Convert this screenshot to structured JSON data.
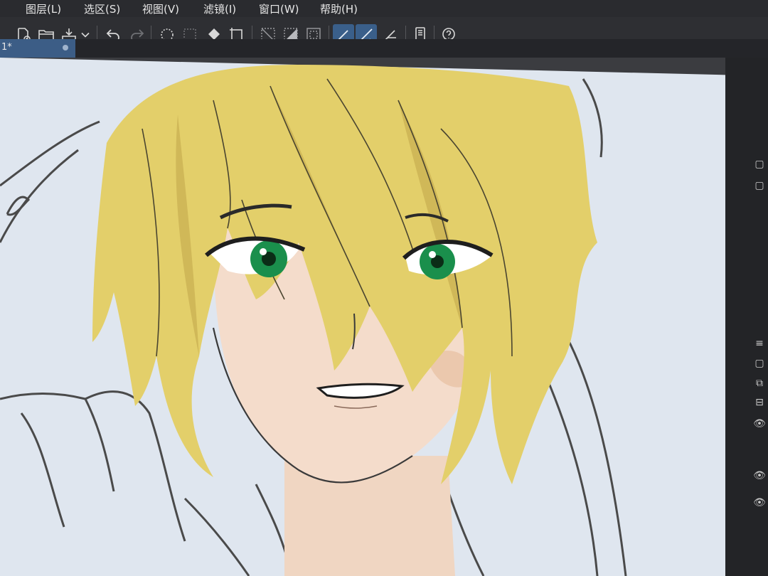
{
  "menu": {
    "items": [
      "图层(L)",
      "选区(S)",
      "视图(V)",
      "滤镜(I)",
      "窗口(W)",
      "帮助(H)"
    ]
  },
  "toolbar": {
    "buttons": [
      {
        "name": "new-file-icon"
      },
      {
        "name": "open-folder-icon"
      },
      {
        "name": "export-icon"
      },
      {
        "name": "dropdown-chevron-icon"
      },
      {
        "name": "undo-icon"
      },
      {
        "name": "redo-icon"
      },
      {
        "name": "clear-icon"
      },
      {
        "name": "selection-icon"
      },
      {
        "name": "fill-icon"
      },
      {
        "name": "transform-icon"
      },
      {
        "name": "ruler-diagonal-icon"
      },
      {
        "name": "ruler-fill-icon"
      },
      {
        "name": "frame-icon"
      },
      {
        "name": "snap-ruler-icon"
      },
      {
        "name": "snap-special-icon"
      },
      {
        "name": "snap-grid-icon"
      },
      {
        "name": "device-icon"
      },
      {
        "name": "help-icon"
      }
    ],
    "active_buttons": [
      "snap-ruler-icon",
      "snap-special-icon"
    ]
  },
  "document": {
    "tab_label": "1*"
  },
  "colors": {
    "hair": "#e3cf6a",
    "hair_shadow": "#cdb455",
    "skin": "#f4dccb",
    "skin_shadow": "#e8c3a5",
    "eye": "#1a8f4c",
    "paper": "#dfe6ef",
    "line": "#3a3a3a",
    "accent": "#3c5d86"
  }
}
